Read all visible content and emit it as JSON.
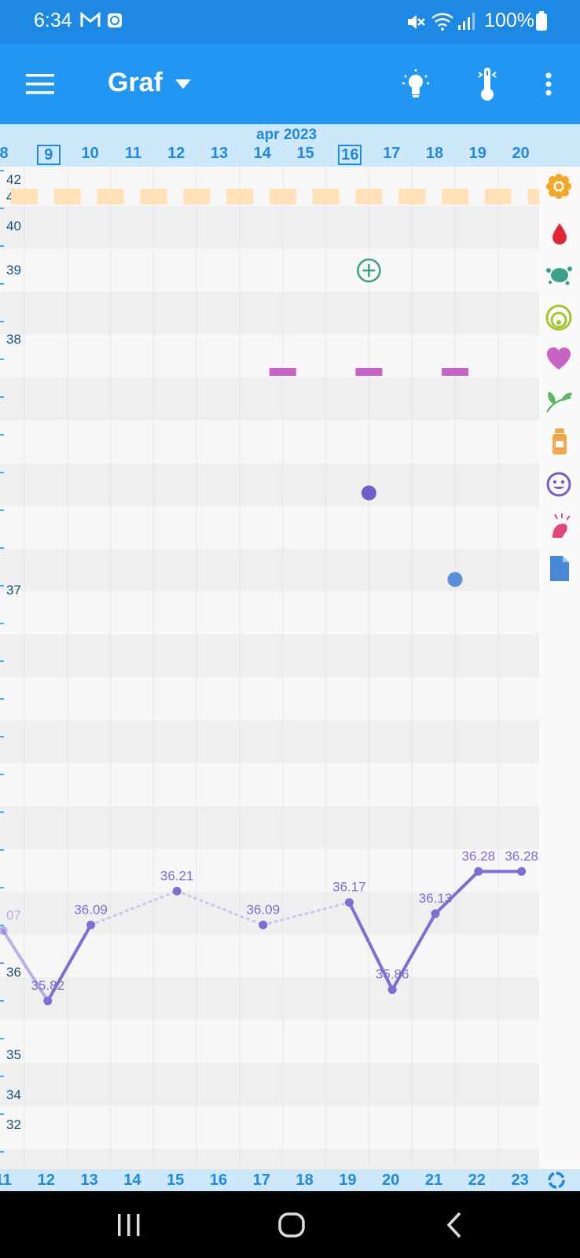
{
  "status": {
    "time": "6:34",
    "battery": "100%",
    "icons": [
      "gmail-icon",
      "clock-app-icon",
      "mute-icon",
      "wifi-icon",
      "signal-icon",
      "battery-icon"
    ]
  },
  "toolbar": {
    "menu_icon": "hamburger-menu-icon",
    "title": "Graf",
    "dropdown_icon": "dropdown-arrow-icon",
    "tips_icon": "lightbulb-icon",
    "temp_icon": "thermometer-icon",
    "more_icon": "more-vertical-icon"
  },
  "chart_header": {
    "month": "apr 2023",
    "top_days": [
      "8",
      "9",
      "10",
      "11",
      "12",
      "13",
      "14",
      "15",
      "16",
      "17",
      "18",
      "19",
      "20"
    ],
    "bottom_days": [
      "11",
      "12",
      "13",
      "14",
      "15",
      "16",
      "17",
      "18",
      "19",
      "20",
      "21",
      "22",
      "23"
    ],
    "highlighted_days": [
      "9",
      "16"
    ]
  },
  "y_axis_labels": [
    "42",
    "41",
    "40",
    "39",
    "38",
    "37",
    "36",
    "35",
    "34",
    "32"
  ],
  "side_icons": [
    "flower-icon",
    "blood-drop-icon",
    "splash-icon",
    "cervix-icon",
    "heart-icon",
    "leaves-icon",
    "medicine-bottle-icon",
    "smiley-icon",
    "pain-icon",
    "note-icon"
  ],
  "bottom_icon": "sync-icon",
  "chart_data": {
    "type": "line",
    "x": [
      "11",
      "12",
      "13",
      "14",
      "15",
      "16",
      "17",
      "18",
      "19",
      "20",
      "21",
      "22",
      "23"
    ],
    "series": [
      {
        "values": [
          36.07,
          35.82,
          36.09,
          null,
          36.21,
          null,
          36.09,
          null,
          36.17,
          35.86,
          36.13,
          36.28,
          36.28
        ],
        "labels": [
          "07",
          "35.82",
          "36.09",
          "",
          "36.21",
          "",
          "36.09",
          "",
          "36.17",
          "35.86",
          "36.13",
          "36.28",
          "36.28"
        ],
        "dotted_segments": [
          [
            2,
            4
          ],
          [
            4,
            6
          ],
          [
            6,
            8
          ]
        ]
      }
    ],
    "color": "#7b6fd6",
    "row_markers": {
      "period_bars_days": [
        "8",
        "9",
        "10",
        "11",
        "12",
        "13",
        "14",
        "15",
        "16",
        "17",
        "18",
        "19",
        "20"
      ],
      "plus_marker_day": "16",
      "heart_marks_days": [
        "14",
        "16",
        "18"
      ],
      "mood_dot_day": "16",
      "note_dot_day": "18"
    },
    "colors": {
      "period": "#ffe1b8",
      "heart": "#c862c6",
      "plus": "#3aa17e",
      "mood": "#6d61c5",
      "note": "#5b8fd9",
      "line": "#7b6fd6"
    }
  },
  "nav": {
    "recent_icon": "recents-icon",
    "home_icon": "home-icon",
    "back_icon": "back-icon"
  }
}
